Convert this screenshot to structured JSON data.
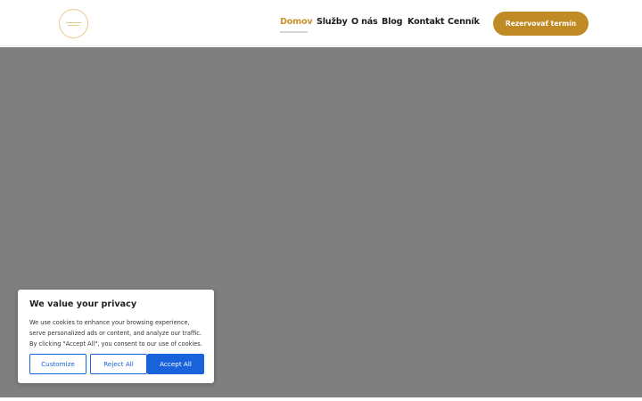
{
  "header": {
    "nav": [
      {
        "label": "Domov",
        "active": true
      },
      {
        "label": "Služby",
        "active": false
      },
      {
        "label": "O nás",
        "active": false
      },
      {
        "label": "Blog",
        "active": false
      },
      {
        "label": "Kontakt",
        "active": false
      },
      {
        "label": "Cenník",
        "active": false
      }
    ],
    "cta_label": "Rezervovať termín"
  },
  "cookie_banner": {
    "title": "We value your privacy",
    "text_line1": "We use cookies to enhance your browsing experience,",
    "text_line2": "serve personalized ads or content, and analyze our traffic.",
    "text_line3": "By clicking \"Accept All\", you consent to our use of cookies.",
    "customize_label": "Customize",
    "reject_label": "Reject All",
    "accept_label": "Accept All"
  },
  "colors": {
    "accent": "#c08a25",
    "active_nav": "#c9922e",
    "hero_background": "#7f7f7f",
    "cookie_button_blue": "#1863dc"
  }
}
